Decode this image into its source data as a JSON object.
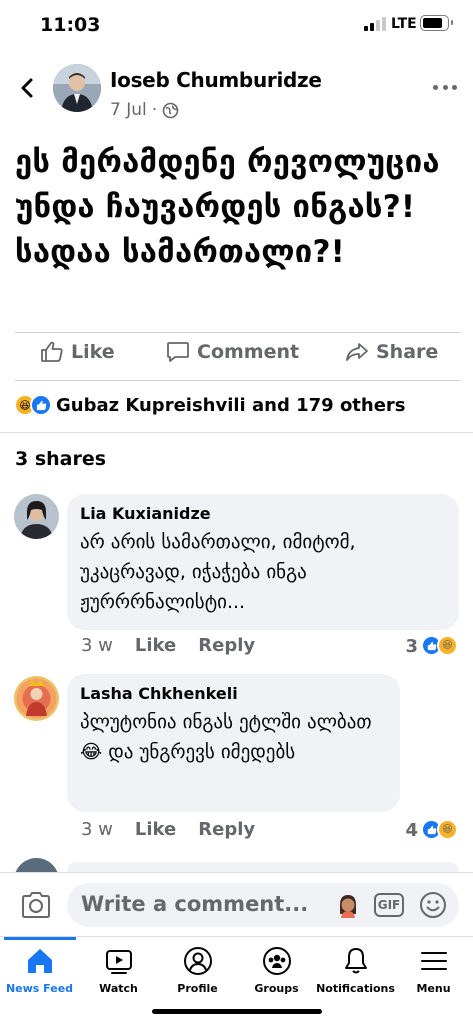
{
  "status_bar": {
    "time": "11:03",
    "network": "LTE",
    "battery_level": 0.85
  },
  "post": {
    "author": "Ioseb Chumburidze",
    "date": "7 Jul",
    "separator": "·",
    "text": "ეს მერამდენე რევოლუცია უნდა ჩაუვარდეს ინგას?! სადაა სამართალი?!",
    "actions": {
      "like": "Like",
      "comment": "Comment",
      "share": "Share"
    },
    "reactions_summary": "Gubaz Kupreishvili and 179 others",
    "shares": "3 shares"
  },
  "comments": [
    {
      "name": "Lia Kuxianidze",
      "text": "არ არის სამართალი, იმიტომ, უკაცრავად, იჭაჭება ინგა ჟურრრნალისტი...",
      "time": "3 w",
      "like_label": "Like",
      "reply_label": "Reply",
      "reaction_count": "3"
    },
    {
      "name": "Lasha Chkhenkeli",
      "text_before_emoji": "პლუტონია ინგას ეტლში ალბათ ",
      "emoji": "😂",
      "text_after_emoji": " და უნგრევს იმედებს",
      "time": "3 w",
      "like_label": "Like",
      "reply_label": "Reply",
      "reaction_count": "4"
    }
  ],
  "composer": {
    "placeholder": "Write a comment...",
    "gif_label": "GIF"
  },
  "tabs": [
    {
      "label": "News Feed",
      "icon": "home-icon",
      "active": true
    },
    {
      "label": "Watch",
      "icon": "watch-icon",
      "active": false
    },
    {
      "label": "Profile",
      "icon": "profile-icon",
      "active": false
    },
    {
      "label": "Groups",
      "icon": "groups-icon",
      "active": false
    },
    {
      "label": "Notifications",
      "icon": "bell-icon",
      "active": false
    },
    {
      "label": "Menu",
      "icon": "menu-icon",
      "active": false
    }
  ],
  "colors": {
    "accent": "#1877f2",
    "muted_text": "#65676b",
    "bubble": "#f0f2f5"
  }
}
